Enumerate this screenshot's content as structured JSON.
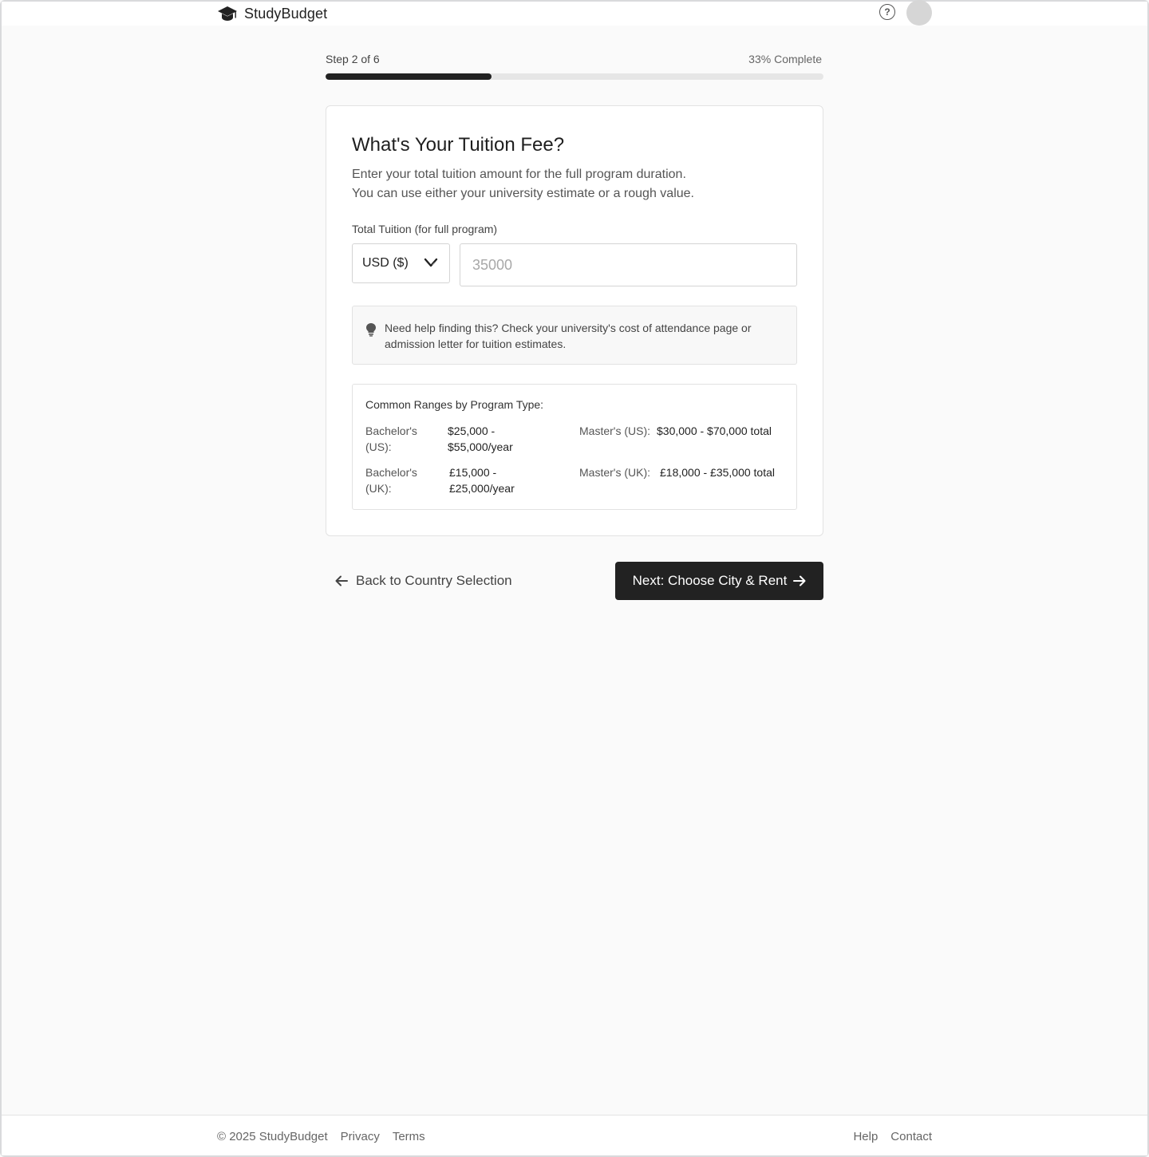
{
  "header": {
    "app_name": "StudyBudget",
    "help_icon_glyph": "?",
    "logo_icon": "graduation-cap-icon"
  },
  "progress": {
    "step_text": "Step 2 of 6",
    "percent_text": "33% Complete",
    "fill_fraction": 0.333
  },
  "card": {
    "title": "What's Your Tuition Fee?",
    "description_line1": "Enter your total tuition amount for the full program duration.",
    "description_line2": "You can use either your university estimate or a rough value.",
    "field_label": "Total Tuition (for full program)",
    "currency_value": "USD ($)",
    "amount_placeholder": "35000",
    "amount_value": "",
    "tip_text": "Need help finding this? Check your university's cost of attendance page or admission letter for tuition estimates.",
    "ranges": {
      "title": "Common Ranges by Program Type:",
      "items": [
        {
          "label_line1": "Bachelor's",
          "label_line2": "(US):",
          "value_line1": "$25,000 -",
          "value_line2": "$55,000/year"
        },
        {
          "label": "Master's (US):",
          "value": "$30,000 - $70,000 total"
        },
        {
          "label_line1": "Bachelor's",
          "label_line2": "(UK):",
          "value_line1": "£15,000 -",
          "value_line2": "£25,000/year"
        },
        {
          "label": "Master's (UK):",
          "value": "£18,000 - £35,000 total"
        }
      ]
    }
  },
  "nav": {
    "back_label": "Back to Country Selection",
    "next_label": "Next: Choose City & Rent"
  },
  "footer": {
    "copyright": "© 2025 StudyBudget",
    "privacy": "Privacy",
    "terms": "Terms",
    "help": "Help",
    "contact": "Contact"
  },
  "colors": {
    "primary": "#222222",
    "background": "#fafafa",
    "border": "#e2e2e2"
  }
}
